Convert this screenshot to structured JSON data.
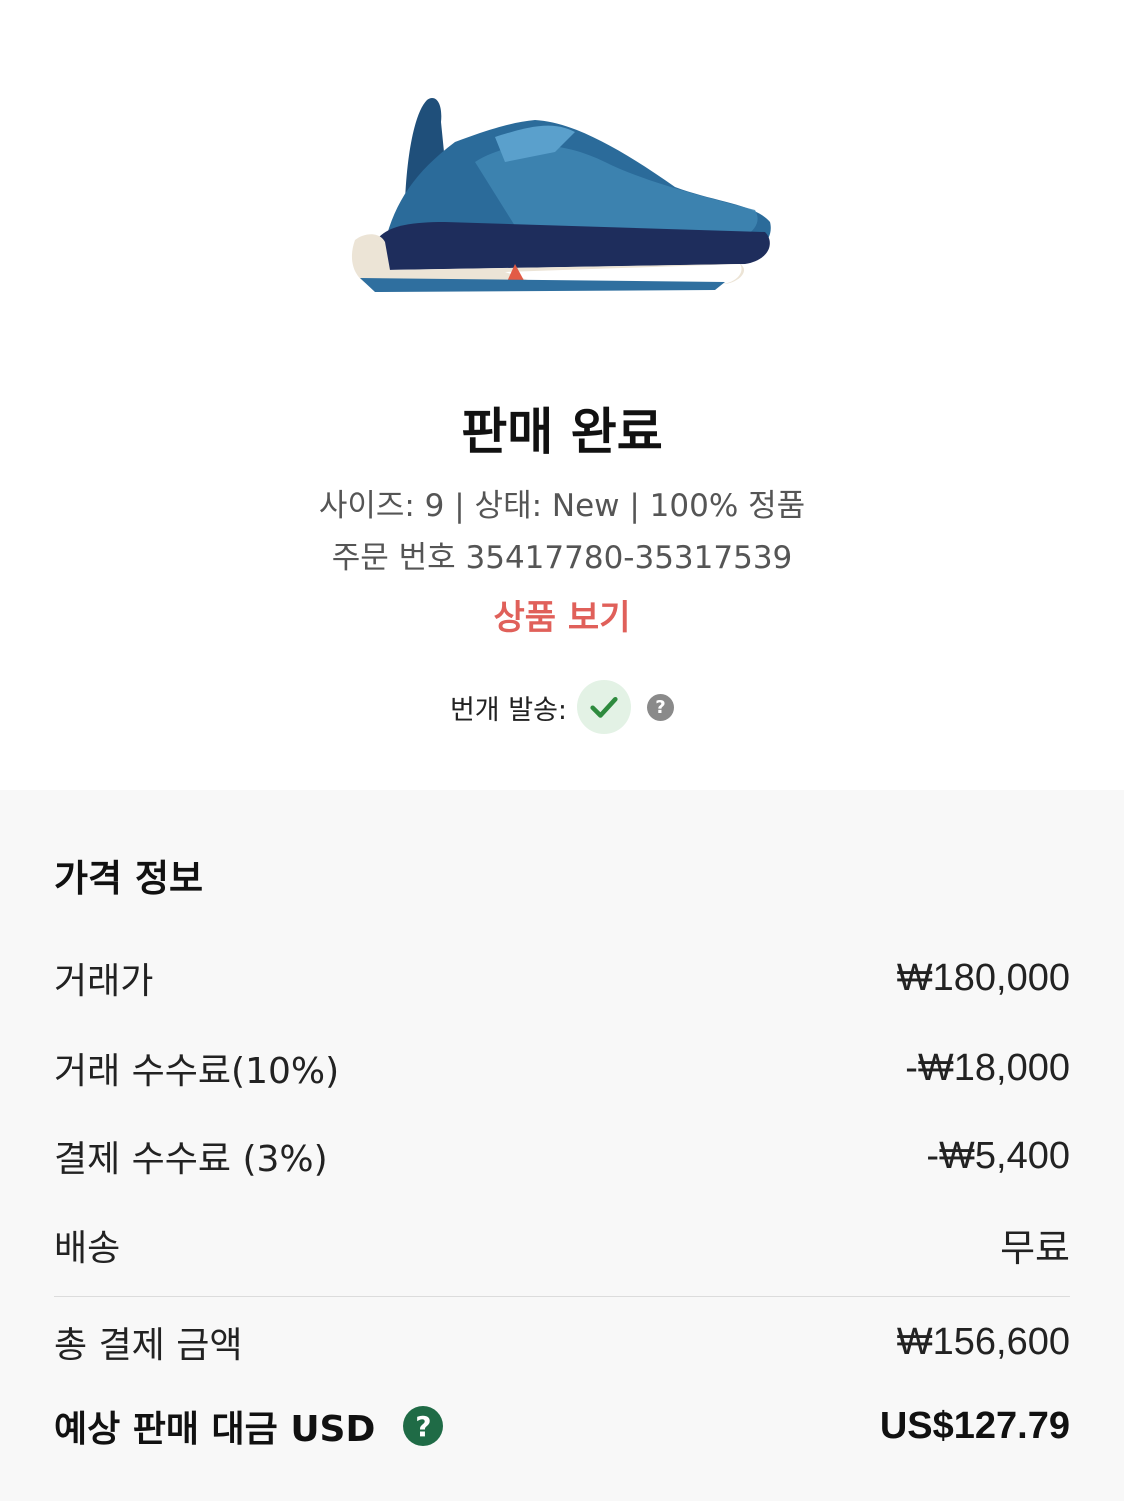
{
  "status": {
    "title": "판매 완료",
    "details_line": "사이즈: 9 | 상태: New | 100% 정품",
    "order_line": "주문 번호 35417780-35317539",
    "view_product_label": "상품 보기",
    "express_label": "번개 발송:",
    "express_enabled": true,
    "help_glyph": "?"
  },
  "price_info": {
    "section_title": "가격 정보",
    "rows": [
      {
        "label": "거래가",
        "value": "₩180,000"
      },
      {
        "label": "거래 수수료(10%)",
        "value": "-₩18,000"
      },
      {
        "label": "결제 수수료 (3%)",
        "value": "-₩5,400"
      },
      {
        "label": "배송",
        "value": "무료"
      }
    ],
    "total": {
      "label": "총 결제 금액",
      "value": "₩156,600"
    },
    "payout": {
      "label": "예상 판매 대금 USD",
      "value": "US$127.79"
    }
  },
  "colors": {
    "accent_link": "#e0605a",
    "check_green": "#2e8b3e",
    "help_green": "#1f6b46",
    "panel_bg": "#f8f8f8"
  },
  "icons": {
    "product": "sneaker-image",
    "express": "checkmark-icon",
    "help": "question-mark-icon"
  }
}
